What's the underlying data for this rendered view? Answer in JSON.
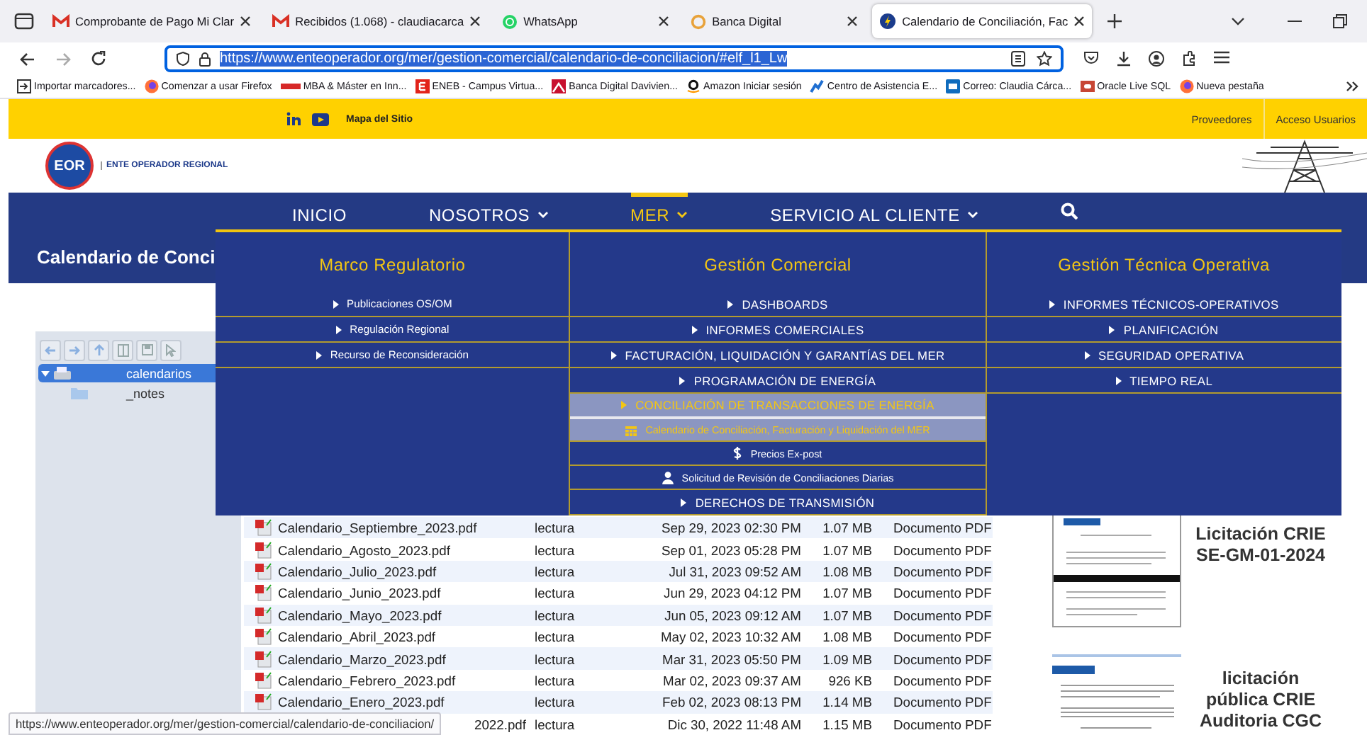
{
  "browser": {
    "tabs": [
      {
        "title": "Comprobante de Pago Mi Clar",
        "selected": false
      },
      {
        "title": "Recibidos (1.068) - claudiacarca",
        "selected": false
      },
      {
        "title": "WhatsApp",
        "selected": false
      },
      {
        "title": "Banca Digital",
        "selected": false
      },
      {
        "title": "Calendario de Conciliación, Fac",
        "selected": true
      }
    ],
    "address": {
      "value": "https://www.enteoperador.org/mer/gestion-comercial/calendario-de-conciliacion/#elf_l1_Lw",
      "selected": true
    },
    "bookmarks": [
      {
        "label": "Importar marcadores..."
      },
      {
        "label": "Comenzar a usar Firefox"
      },
      {
        "label": "MBA & Máster en Inn..."
      },
      {
        "label": "ENEB - Campus Virtua..."
      },
      {
        "label": "Banca Digital Davivien..."
      },
      {
        "label": "Amazon Iniciar sesión"
      },
      {
        "label": "Centro de Asistencia E..."
      },
      {
        "label": "Correo: Claudia Cárca..."
      },
      {
        "label": "Oracle Live SQL"
      },
      {
        "label": "Nueva pestaña"
      }
    ],
    "status_url": "https://www.enteoperador.org/mer/gestion-comercial/calendario-de-conciliacion/"
  },
  "site": {
    "topbar": {
      "sitemap": "Mapa del Sitio",
      "links": [
        "Proveedores",
        "Acceso Usuarios"
      ]
    },
    "logo": {
      "mark": "EOR",
      "name": "ENTE OPERADOR REGIONAL"
    },
    "nav": [
      {
        "label": "INICIO",
        "dropdown": false,
        "selected": false
      },
      {
        "label": "NOSOTROS",
        "dropdown": true,
        "selected": false
      },
      {
        "label": "MER",
        "dropdown": true,
        "selected": true
      },
      {
        "label": "SERVICIO AL CLIENTE",
        "dropdown": true,
        "selected": false
      }
    ],
    "page_title": "Calendario de Conci",
    "mega_menu": [
      {
        "heading": "Marco Regulatorio",
        "items": [
          {
            "label": "Publicaciones OS/OM",
            "kind": "link",
            "selected": false
          },
          {
            "label": "Regulación Regional",
            "kind": "link",
            "selected": false
          },
          {
            "label": "Recurso de Reconsideración",
            "kind": "link",
            "selected": false
          }
        ]
      },
      {
        "heading": "Gestión Comercial",
        "items": [
          {
            "label": "DASHBOARDS",
            "kind": "section",
            "selected": false
          },
          {
            "label": "INFORMES COMERCIALES",
            "kind": "section",
            "selected": false
          },
          {
            "label": "FACTURACIÓN, LIQUIDACIÓN Y GARANTÍAS DEL MER",
            "kind": "section",
            "selected": false
          },
          {
            "label": "PROGRAMACIÓN DE ENERGÍA",
            "kind": "section",
            "selected": false
          },
          {
            "label": "CONCILIACIÓN DE TRANSACCIONES DE ENERGÍA",
            "kind": "section",
            "selected": true
          },
          {
            "label": "Calendario de Conciliación, Facturación y Liquidación del MER",
            "kind": "calendar",
            "selected": true
          },
          {
            "label": "Precios Ex-post",
            "kind": "price",
            "selected": false
          },
          {
            "label": "Solicitud de Revisión de Conciliaciones Diarias",
            "kind": "request",
            "selected": false
          },
          {
            "label": "DERECHOS DE TRANSMISIÓN",
            "kind": "section",
            "selected": false
          }
        ]
      },
      {
        "heading": "Gestión Técnica Operativa",
        "items": [
          {
            "label": "INFORMES TÉCNICOS-OPERATIVOS",
            "kind": "section",
            "selected": false
          },
          {
            "label": "PLANIFICACIÓN",
            "kind": "section",
            "selected": false
          },
          {
            "label": "SEGURIDAD OPERATIVA",
            "kind": "section",
            "selected": false
          },
          {
            "label": "TIEMPO REAL",
            "kind": "section",
            "selected": false
          }
        ]
      }
    ],
    "file_manager": {
      "tree": [
        {
          "label": "calendarios",
          "kind": "drive",
          "expanded": true,
          "selected": true
        },
        {
          "label": "_notes",
          "kind": "folder",
          "expanded": false,
          "selected": false
        }
      ],
      "files": [
        {
          "name": "Calendario_Septiembre_2023.pdf",
          "kind": "file",
          "permission": "lectura",
          "date": "Sep 29, 2023 02:30 PM",
          "size": "1.07 MB",
          "type": "Documento PDF"
        },
        {
          "name": "Calendario_Agosto_2023.pdf",
          "kind": "file",
          "permission": "lectura",
          "date": "Sep 01, 2023 05:28 PM",
          "size": "1.07 MB",
          "type": "Documento PDF"
        },
        {
          "name": "Calendario_Julio_2023.pdf",
          "kind": "file",
          "permission": "lectura",
          "date": "Jul 31, 2023 09:52 AM",
          "size": "1.08 MB",
          "type": "Documento PDF"
        },
        {
          "name": "Calendario_Junio_2023.pdf",
          "kind": "file",
          "permission": "lectura",
          "date": "Jun 29, 2023 04:12 PM",
          "size": "1.07 MB",
          "type": "Documento PDF"
        },
        {
          "name": "Calendario_Mayo_2023.pdf",
          "kind": "file",
          "permission": "lectura",
          "date": "Jun 05, 2023 09:12 AM",
          "size": "1.07 MB",
          "type": "Documento PDF"
        },
        {
          "name": "Calendario_Abril_2023.pdf",
          "kind": "file",
          "permission": "lectura",
          "date": "May 02, 2023 10:32 AM",
          "size": "1.08 MB",
          "type": "Documento PDF"
        },
        {
          "name": "Calendario_Marzo_2023.pdf",
          "kind": "file",
          "permission": "lectura",
          "date": "Mar 31, 2023 05:50 PM",
          "size": "1.09 MB",
          "type": "Documento PDF"
        },
        {
          "name": "Calendario_Febrero_2023.pdf",
          "kind": "file",
          "permission": "lectura",
          "date": "Mar 02, 2023 09:37 AM",
          "size": "926 KB",
          "type": "Documento PDF"
        },
        {
          "name": "Calendario_Enero_2023.pdf",
          "kind": "file",
          "permission": "lectura",
          "date": "Feb 02, 2023 08:13 PM",
          "size": "1.14 MB",
          "type": "Documento PDF"
        },
        {
          "name": "2022.pdf",
          "kind": "covered",
          "permission": "lectura",
          "date": "Dic 30, 2022 11:48 AM",
          "size": "1.15 MB",
          "type": "Documento PDF"
        }
      ]
    },
    "notices": [
      {
        "lines": [
          "Licitación CRIE",
          "SE-GM-01-2024"
        ]
      },
      {
        "lines": [
          "licitación",
          "pública CRIE",
          "Auditoria CGC"
        ]
      }
    ]
  }
}
